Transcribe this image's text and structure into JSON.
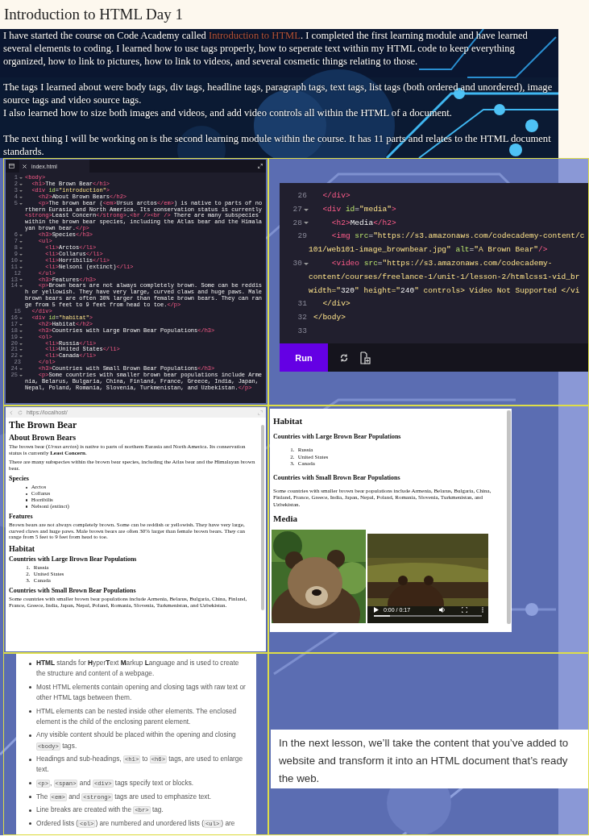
{
  "post_title": "Introduction to HTML Day 1",
  "intro": {
    "paragraphs": [
      [
        [
          {
            "kind": "text",
            "text": "I have started the course on Code Academy called "
          },
          {
            "kind": "link",
            "text": "Introduction to HTML"
          },
          {
            "kind": "text",
            "text": ". I completed the first learning module and have learned several elements to coding. I learned how to use tags properly, how to seperate text within my HTML code to keep everything organized, how to link to pictures, how to link to videos, and several cosmetic things relating to those."
          }
        ]
      ],
      [
        [
          {
            "kind": "text",
            "text": "The tags I learned about were body tags, div tags, headline tags, paragraph tags, text tags, list tags (both ordered and unordered), image source tags and video source tags."
          }
        ],
        [
          {
            "kind": "text",
            "text": "I also learned how to size both images and videos, and add video controls all within the HTML of a document."
          }
        ]
      ],
      [
        [
          {
            "kind": "text",
            "text": "The next thing I will be working on is the second learning module within the course. It has 11 parts and relates to the HTML document standards."
          }
        ]
      ]
    ]
  },
  "editor_main": {
    "tab": "index.html",
    "lines": [
      {
        "num": "1",
        "fold": true,
        "code": "<body>"
      },
      {
        "num": "2",
        "fold": true,
        "code": "  <h1>The Brown Bear</h1>"
      },
      {
        "num": "3",
        "fold": true,
        "code": "  <div id=\"introduction\">"
      },
      {
        "num": "4",
        "fold": true,
        "code": "    <h2>About Brown Bears</h2>"
      },
      {
        "num": "5",
        "fold": true,
        "code": "    <p>The brown bear (<em>Ursus arctos</em>) is native to parts of northern Eurasia and North America. Its conservation status is currently <strong>Least Concern</strong>.<br /><br /> There are many subspecies within the brown bear species, including the Atlas bear and the Himalayan brown bear.</p>"
      },
      {
        "num": "6",
        "fold": true,
        "code": "    <h3>Species</h3>"
      },
      {
        "num": "7",
        "fold": true,
        "code": "    <ul>"
      },
      {
        "num": "8",
        "fold": true,
        "code": "      <li>Arctos</li>"
      },
      {
        "num": "9",
        "fold": true,
        "code": "      <li>Collarus</li>"
      },
      {
        "num": "10",
        "fold": true,
        "code": "      <li>Horribilis</li>"
      },
      {
        "num": "11",
        "fold": true,
        "code": "      <li>Nelsoni (extinct)</li>"
      },
      {
        "num": "12",
        "fold": false,
        "code": "    </ul>"
      },
      {
        "num": "13",
        "fold": true,
        "code": "    <h3>Features</h3>"
      },
      {
        "num": "14",
        "fold": true,
        "code": "    <p>Brown bears are not always completely brown. Some can be reddish or yellowish. They have very large, curved claws and huge paws. Male brown bears are often 30% larger than female brown bears. They can range from 5 feet to 9 feet from head to toe.</p>"
      },
      {
        "num": "15",
        "fold": false,
        "code": "  </div>"
      },
      {
        "num": "16",
        "fold": true,
        "code": "  <div id=\"habitat\">"
      },
      {
        "num": "17",
        "fold": true,
        "code": "    <h2>Habitat</h2>"
      },
      {
        "num": "18",
        "fold": true,
        "code": "    <h3>Countries with Large Brown Bear Populations</h3>"
      },
      {
        "num": "19",
        "fold": true,
        "code": "    <ol>"
      },
      {
        "num": "20",
        "fold": true,
        "code": "      <li>Russia</li>"
      },
      {
        "num": "21",
        "fold": true,
        "code": "      <li>United States</li>"
      },
      {
        "num": "22",
        "fold": true,
        "code": "      <li>Canada</li>"
      },
      {
        "num": "23",
        "fold": false,
        "code": "    </ol>"
      },
      {
        "num": "24",
        "fold": true,
        "code": "    <h3>Countries with Small Brown Bear Populations</h3>"
      },
      {
        "num": "25",
        "fold": true,
        "code": "    <p>Some countries with smaller brown bear populations include Armenia, Belarus, Bulgaria, China, Finland, France, Greece, India, Japan, Nepal, Poland, Romania, Slovenia, Turkmenistan, and Uzbekistan.</p>"
      }
    ]
  },
  "editor_bottom": {
    "rows": [
      {
        "num": "26",
        "fold": false,
        "code": "  </div>"
      },
      {
        "num": "27",
        "fold": true,
        "code": "  <div id=\"media\">"
      },
      {
        "num": "28",
        "fold": true,
        "code": "    <h2>Media</h2>"
      },
      {
        "num": "29",
        "fold": false,
        "code": "    <img src=\"https://s3.amazonaws.com/codecademy-content/c"
      },
      {
        "code": "101/web101-image_brownbear.jpg\" alt=\"A Brown Bear\"/>"
      },
      {
        "num": "30",
        "fold": true,
        "code": "    <video src=\"https://s3.amazonaws.com/codecademy-"
      },
      {
        "code": "content/courses/freelance-1/unit-1/lesson-2/htmlcss1-vid_br"
      },
      {
        "code": "width=\"320\" height=\"240\" controls> Video Not Supported </vi"
      },
      {
        "num": "31",
        "fold": false,
        "code": "  </div>"
      },
      {
        "num": "32",
        "fold": false,
        "code": "</body>"
      },
      {
        "num": "33",
        "fold": false,
        "code": ""
      }
    ],
    "run_button": "Run"
  },
  "preview_top": {
    "url": "https://localhost/",
    "blocks": [
      {
        "kind": "h1",
        "text": "The Brown Bear"
      },
      {
        "kind": "h2",
        "text": "About Brown Bears"
      },
      {
        "kind": "p",
        "text": "The brown bear (*Ursus arctos*) is native to parts of northern Eurasia and North America. Its conservation status is currently **Least Concern**."
      },
      {
        "kind": "p",
        "text": "There are many subspecies within the brown bear species, including the Atlas bear and the Himalayan brown bear."
      },
      {
        "kind": "h3",
        "text": "Species"
      },
      {
        "kind": "ul",
        "items": [
          "Arctos",
          "Collarus",
          "Horribilis",
          "Nelsoni (extinct)"
        ]
      },
      {
        "kind": "h3",
        "text": "Features"
      },
      {
        "kind": "p",
        "text": "Brown bears are not always completely brown. Some can be reddish or yellowish. They have very large, curved claws and huge paws. Male brown bears are often 30% larger than female brown bears. They can range from 5 feet to 9 feet from head to toe."
      },
      {
        "kind": "h2",
        "text": "Habitat"
      },
      {
        "kind": "h3",
        "text": "Countries with Large Brown Bear Populations"
      },
      {
        "kind": "ol",
        "items": [
          {
            "number": "1.",
            "text": "Russia"
          },
          {
            "number": "2.",
            "text": "United States"
          },
          {
            "number": "3.",
            "text": "Canada"
          }
        ]
      },
      {
        "kind": "h3",
        "text": "Countries with Small Brown Bear Populations"
      },
      {
        "kind": "p",
        "text": "Some countries with smaller brown bear populations include Armenia, Belarus, Bulgaria, China, Finland, France, Greece, India, Japan, Nepal, Poland, Romania, Slovenia, Turkmenistan, and Uzbekistan."
      }
    ]
  },
  "preview_media": {
    "blocks": [
      {
        "kind": "h2",
        "text": "Habitat"
      },
      {
        "kind": "h3",
        "text": "Countries with Large Brown Bear Populations"
      },
      {
        "kind": "ol",
        "items": [
          {
            "number": "1.",
            "text": "Russia"
          },
          {
            "number": "2.",
            "text": "United States"
          },
          {
            "number": "3.",
            "text": "Canada"
          }
        ]
      },
      {
        "kind": "h3",
        "text": "Countries with Small Brown Bear Populations"
      },
      {
        "kind": "p",
        "text": "Some countries with smaller brown bear populations include Armenia, Belarus, Bulgaria, China, Finland, France, Greece, India, Japan, Nepal, Poland, Romania, Slovenia, Turkmenistan, and Uzbekistan."
      },
      {
        "kind": "h2",
        "text": "Media"
      },
      {
        "kind": "media",
        "time": "0:00 / 0:17",
        "level": 0.15
      }
    ]
  },
  "cheatsheet": {
    "items": [
      [
        {
          "kind": "text",
          "text": "**HTML** stands for **H**yper**T**ext **M**arkup **L**anguage and is used to create the structure and content of a webpage."
        }
      ],
      [
        {
          "kind": "text",
          "text": "Most HTML elements contain opening and closing tags with raw text or other HTML tags between them."
        }
      ],
      [
        {
          "kind": "text",
          "text": "HTML elements can be nested inside other elements. The enclosed element is the child of the enclosing parent element."
        }
      ],
      [
        {
          "kind": "text",
          "text": "Any visible content should be placed within the opening and closing "
        },
        {
          "kind": "code",
          "text": "<body>"
        },
        {
          "kind": "text",
          "text": " tags."
        }
      ],
      [
        {
          "kind": "text",
          "text": "Headings and sub-headings, "
        },
        {
          "kind": "code",
          "text": "<h1>"
        },
        {
          "kind": "text",
          "text": " to "
        },
        {
          "kind": "code",
          "text": "<h6>"
        },
        {
          "kind": "text",
          "text": " tags, are used to enlarge text."
        }
      ],
      [
        {
          "kind": "code",
          "text": "<p>"
        },
        {
          "kind": "text",
          "text": ", "
        },
        {
          "kind": "code",
          "text": "<span>"
        },
        {
          "kind": "text",
          "text": " and "
        },
        {
          "kind": "code",
          "text": "<div>"
        },
        {
          "kind": "text",
          "text": " tags specify text or blocks."
        }
      ],
      [
        {
          "kind": "text",
          "text": "The "
        },
        {
          "kind": "code",
          "text": "<em>"
        },
        {
          "kind": "text",
          "text": " and "
        },
        {
          "kind": "code",
          "text": "<strong>"
        },
        {
          "kind": "text",
          "text": " tags are used to emphasize text."
        }
      ],
      [
        {
          "kind": "text",
          "text": "Line breaks are created with the "
        },
        {
          "kind": "code",
          "text": "<br>"
        },
        {
          "kind": "text",
          "text": " tag."
        }
      ],
      [
        {
          "kind": "text",
          "text": "Ordered lists ("
        },
        {
          "kind": "code",
          "text": "<ol>"
        },
        {
          "kind": "text",
          "text": ") are numbered and unordered lists ("
        },
        {
          "kind": "code",
          "text": "<ul>"
        },
        {
          "kind": "text",
          "text": ") are"
        }
      ]
    ]
  },
  "next_lesson": {
    "lines": [
      "In the next lesson, we’ll take the content that you’ve added to",
      "website and transform it into an HTML document that’s ready",
      "the web."
    ]
  }
}
